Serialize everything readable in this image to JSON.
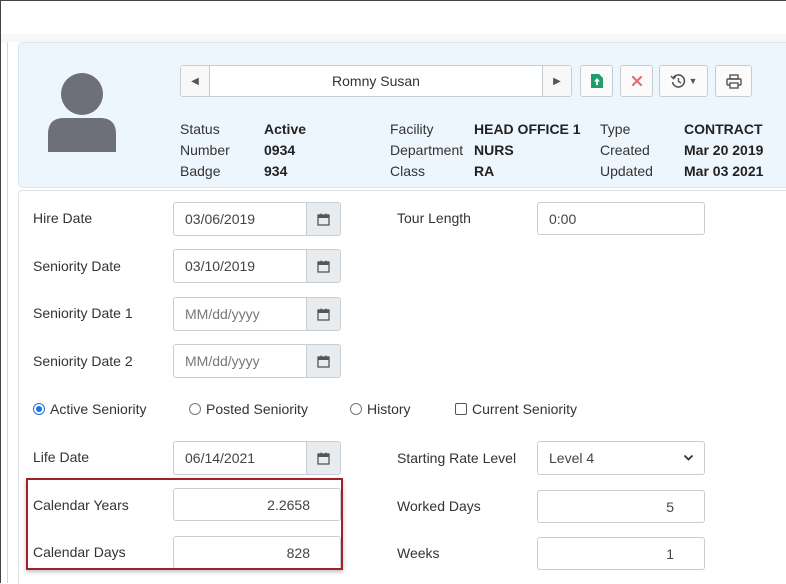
{
  "employee": {
    "name": "Romny Susan",
    "status_label": "Status",
    "status_value": "Active",
    "number_label": "Number",
    "number_value": "0934",
    "badge_label": "Badge",
    "badge_value": "934",
    "facility_label": "Facility",
    "facility_value": "HEAD OFFICE 1",
    "department_label": "Department",
    "department_value": "NURS",
    "class_label": "Class",
    "class_value": "RA",
    "type_label": "Type",
    "type_value": "CONTRACT",
    "created_label": "Created",
    "created_value": "Mar 20 2019",
    "updated_label": "Updated",
    "updated_value": "Mar 03 2021"
  },
  "toolbar": {
    "icons": [
      "chevron-left-icon",
      "chevron-right-icon",
      "export-icon",
      "delete-icon",
      "history-icon",
      "print-icon"
    ],
    "colors": {
      "export": "#1e9e6a",
      "delete": "#e07070"
    }
  },
  "form": {
    "hire_date": {
      "label": "Hire Date",
      "value": "03/06/2019"
    },
    "seniority_date": {
      "label": "Seniority Date",
      "value": "03/10/2019"
    },
    "seniority_date_1": {
      "label": "Seniority Date 1",
      "placeholder": "MM/dd/yyyy"
    },
    "seniority_date_2": {
      "label": "Seniority Date 2",
      "placeholder": "MM/dd/yyyy"
    },
    "tour_length": {
      "label": "Tour Length",
      "value": "0:00"
    },
    "radios": {
      "active_seniority": "Active Seniority",
      "posted_seniority": "Posted Seniority",
      "history": "History",
      "selected": "Active Seniority"
    },
    "current_seniority": {
      "label": "Current Seniority",
      "checked": false
    },
    "life_date": {
      "label": "Life Date",
      "value": "06/14/2021"
    },
    "starting_rate_level": {
      "label": "Starting Rate Level",
      "value": "Level 4"
    },
    "calendar_years": {
      "label": "Calendar Years",
      "value": "2.2658"
    },
    "calendar_days": {
      "label": "Calendar Days",
      "value": "828"
    },
    "worked_days": {
      "label": "Worked Days",
      "value": "5"
    },
    "weeks": {
      "label": "Weeks",
      "value": "1"
    }
  },
  "highlight_color": "#a32027",
  "accent_color": "#1a73e8"
}
